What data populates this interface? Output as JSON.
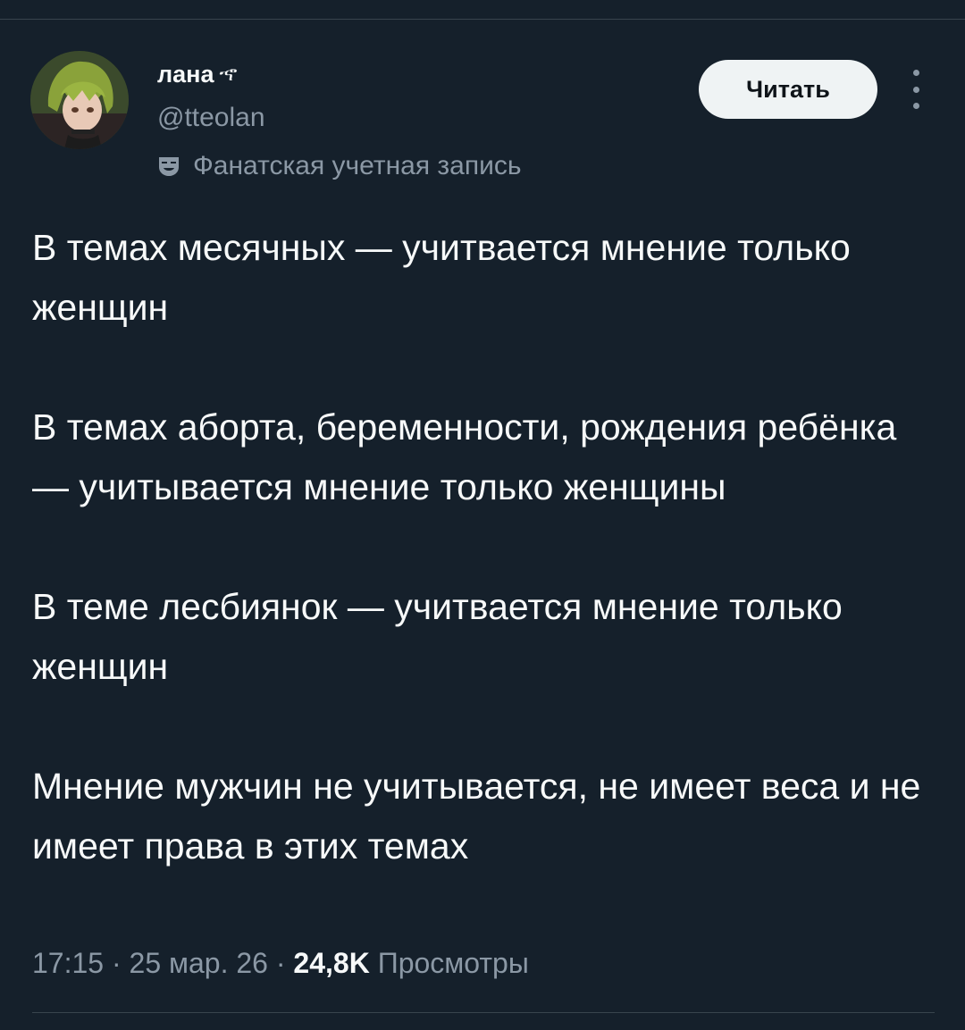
{
  "author": {
    "display_name": "лана",
    "name_glyph": "ኆ",
    "handle": "@tteolan",
    "account_label": "Фанатская учетная запись"
  },
  "actions": {
    "follow_label": "Читать"
  },
  "tweet": {
    "paragraphs": [
      "В темах месячных — учитвается мнение только женщин",
      "В темах аборта, беременности, рождения ребёнка — учитывается мнение только женщины",
      "В теме лесбиянок — учитвается мнение только женщин",
      "Мнение мужчин не учитывается, не имеет веса и не имеет права в этих темах"
    ]
  },
  "meta": {
    "time": "17:15",
    "separator": "·",
    "date": "25 мар. 26",
    "views_count": "24,8K",
    "views_label": "Просмотры"
  },
  "colors": {
    "background": "#15202b",
    "primary_text": "#f7f9f9",
    "secondary_text": "#8b98a5",
    "divider": "#38444d",
    "button_bg": "#eff3f4"
  },
  "icons": {
    "label_icon": "theater-mask-icon",
    "more_icon": "more-vertical-icon"
  }
}
